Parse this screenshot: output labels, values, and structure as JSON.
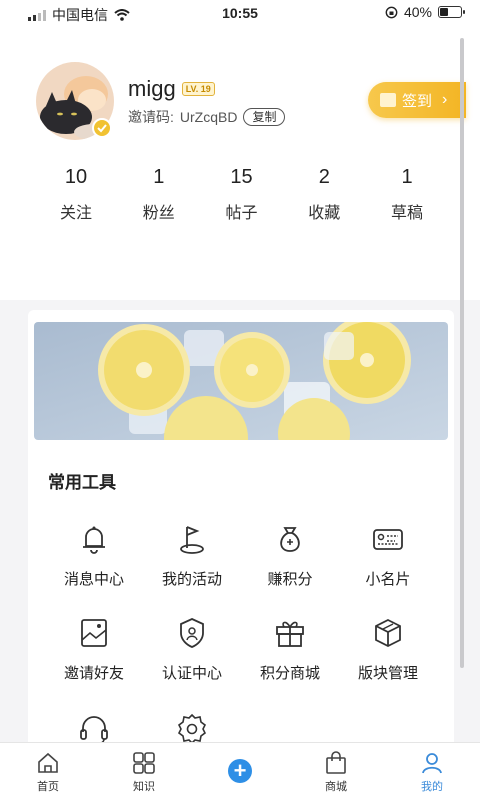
{
  "status": {
    "carrier": "中国电信",
    "time": "10:55",
    "battery": "40%",
    "battery_level": 0.4
  },
  "profile": {
    "username": "migg",
    "level_badge": "LV. 19",
    "invite_label": "邀请码:",
    "invite_code": "UrZcqBD",
    "copy_label": "复制",
    "signin_label": "签到"
  },
  "stats": [
    {
      "value": "10",
      "label": "关注"
    },
    {
      "value": "1",
      "label": "粉丝"
    },
    {
      "value": "15",
      "label": "帖子"
    },
    {
      "value": "2",
      "label": "收藏"
    },
    {
      "value": "1",
      "label": "草稿"
    }
  ],
  "tools": {
    "title": "常用工具",
    "items": [
      {
        "label": "消息中心",
        "icon": "bell-icon"
      },
      {
        "label": "我的活动",
        "icon": "flag-icon"
      },
      {
        "label": "赚积分",
        "icon": "money-bag-icon"
      },
      {
        "label": "小名片",
        "icon": "card-icon"
      },
      {
        "label": "邀请好友",
        "icon": "picture-icon"
      },
      {
        "label": "认证中心",
        "icon": "shield-icon"
      },
      {
        "label": "积分商城",
        "icon": "gift-icon"
      },
      {
        "label": "版块管理",
        "icon": "cube-icon"
      },
      {
        "label": "",
        "icon": "headset-icon"
      },
      {
        "label": "",
        "icon": "gear-icon"
      }
    ]
  },
  "tabbar": [
    {
      "label": "首页",
      "icon": "home-icon"
    },
    {
      "label": "知识",
      "icon": "grid-icon"
    },
    {
      "label": "",
      "icon": "add-icon"
    },
    {
      "label": "商城",
      "icon": "bag-icon"
    },
    {
      "label": "我的",
      "icon": "user-icon",
      "active": true
    }
  ]
}
